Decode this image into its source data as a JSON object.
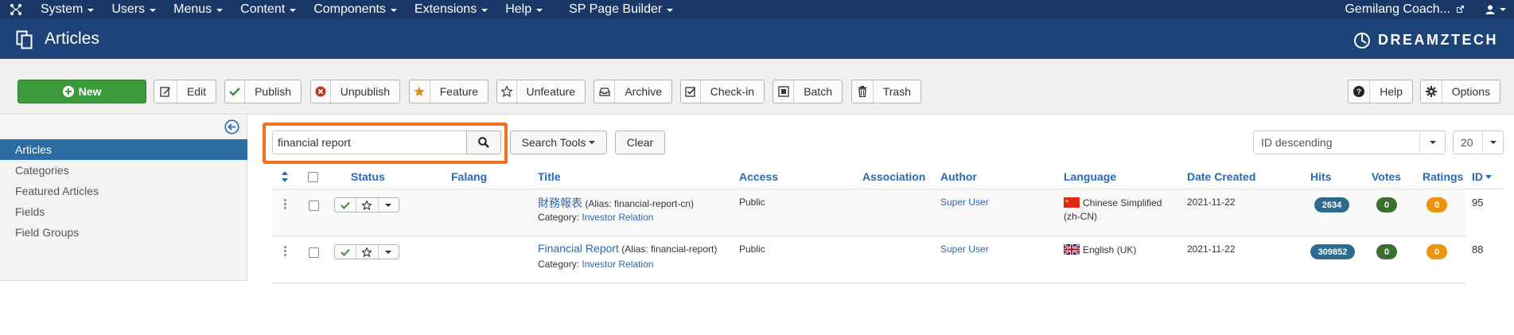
{
  "topnav": {
    "items": [
      {
        "label": "System"
      },
      {
        "label": "Users"
      },
      {
        "label": "Menus"
      },
      {
        "label": "Content"
      },
      {
        "label": "Components"
      },
      {
        "label": "Extensions"
      },
      {
        "label": "Help"
      },
      {
        "label": "SP Page Builder"
      }
    ],
    "site_name": "Gemilang Coach...",
    "bg_color": "#1a3867"
  },
  "header": {
    "title": "Articles",
    "brand": "DREAMZTECH",
    "bg_color": "#1d4379"
  },
  "toolbar": {
    "new": "New",
    "edit": "Edit",
    "publish": "Publish",
    "unpublish": "Unpublish",
    "feature": "Feature",
    "unfeature": "Unfeature",
    "archive": "Archive",
    "checkin": "Check-in",
    "batch": "Batch",
    "trash": "Trash",
    "help": "Help",
    "options": "Options"
  },
  "sidebar": {
    "items": [
      {
        "label": "Articles",
        "active": true
      },
      {
        "label": "Categories"
      },
      {
        "label": "Featured Articles"
      },
      {
        "label": "Fields"
      },
      {
        "label": "Field Groups"
      }
    ]
  },
  "search": {
    "value": "financial report",
    "search_tools": "Search Tools",
    "clear": "Clear",
    "highlight_color": "#f36f24"
  },
  "ordering": {
    "selected": "ID descending"
  },
  "limit": {
    "selected": "20"
  },
  "table": {
    "headers": {
      "status": "Status",
      "falang": "Falang",
      "title": "Title",
      "access": "Access",
      "association": "Association",
      "author": "Author",
      "language": "Language",
      "date_created": "Date Created",
      "hits": "Hits",
      "votes": "Votes",
      "ratings": "Ratings",
      "id": "ID"
    },
    "rows": [
      {
        "title": "財務報表",
        "alias": "(Alias: financial-report-cn)",
        "category_label": "Category:",
        "category": "Investor Relation",
        "access": "Public",
        "author": "Super User",
        "language_line1": "Chinese Simplified",
        "language_line2": "(zh-CN)",
        "date_created": "2021-11-22",
        "hits": "2634",
        "votes": "0",
        "ratings": "0",
        "id": "95"
      },
      {
        "title": "Financial Report",
        "alias": "(Alias: financial-report)",
        "category_label": "Category:",
        "category": "Investor Relation",
        "access": "Public",
        "author": "Super User",
        "language_line1": "English (UK)",
        "date_created": "2021-11-22",
        "hits": "309852",
        "votes": "0",
        "ratings": "0",
        "id": "88"
      }
    ],
    "colors": {
      "hits": "#2d6a8f",
      "votes": "#3a6f30",
      "ratings": "#f0930c",
      "link": "#2a69b8"
    }
  }
}
